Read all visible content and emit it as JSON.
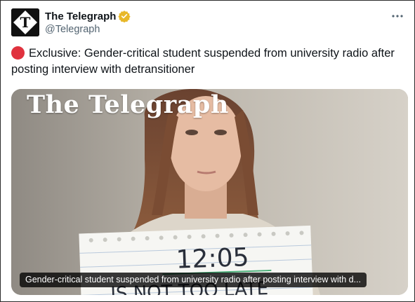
{
  "account": {
    "name": "The Telegraph",
    "handle": "@Telegraph",
    "avatar_letter": "T",
    "verified_color": "#e8b829"
  },
  "more_label": "···",
  "tweet": {
    "emoji": "red-circle",
    "text": "Exclusive: Gender-critical student suspended from university radio after posting interview with detransitioner"
  },
  "media": {
    "masthead": "The Telegraph",
    "sign_time": "12:05",
    "sign_text": "IS NOT TOO LATE",
    "caption": "Gender-critical student suspended from university radio after posting interview with d..."
  },
  "colors": {
    "red_dot": "#e0323e",
    "text_primary": "#0f1419",
    "text_secondary": "#536471"
  }
}
